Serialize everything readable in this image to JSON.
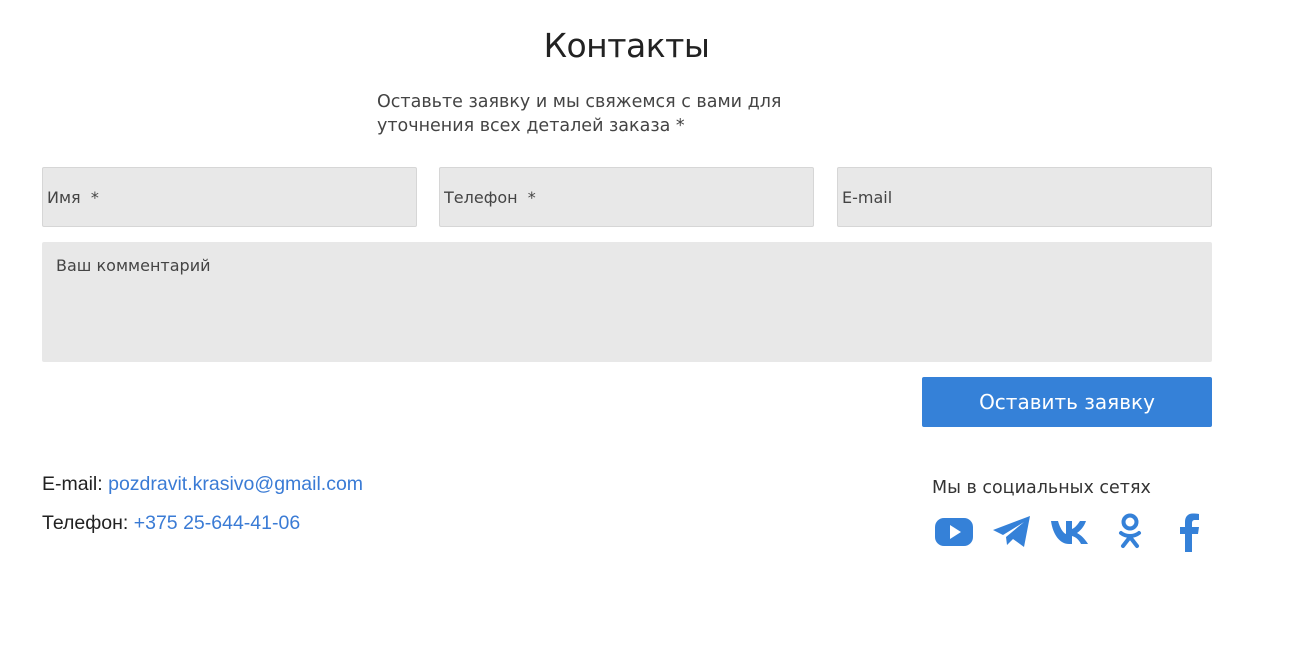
{
  "section": {
    "title": "Контакты",
    "subtitle": "Оставьте заявку и мы свяжемся с вами для уточнения всех деталей заказа *"
  },
  "form": {
    "name_placeholder": "Имя  *",
    "phone_placeholder": "Телефон  *",
    "email_placeholder": "E-mail",
    "comment_placeholder": "Ваш комментарий",
    "submit_label": "Оставить заявку"
  },
  "contacts": {
    "email_label": "E-mail: ",
    "email_value": "pozdravit.krasivo@gmail.com",
    "phone_label": "Телефон: ",
    "phone_value": "+375 25-644-41-06"
  },
  "social": {
    "heading": "Мы в социальных сетях",
    "icons": [
      "youtube-icon",
      "telegram-icon",
      "vk-icon",
      "odnoklassniki-icon",
      "facebook-icon"
    ],
    "accent_color": "#3581d8"
  },
  "colors": {
    "accent": "#3581d8",
    "link": "#3a7bd5",
    "field_background": "#e8e8e8"
  }
}
